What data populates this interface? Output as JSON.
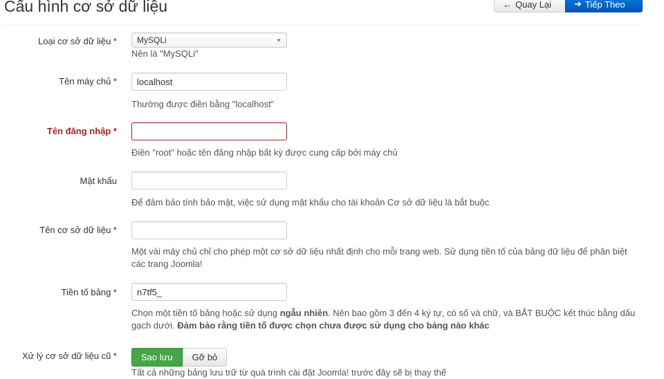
{
  "title": "Cấu hình cơ sở dữ liệu",
  "buttons": {
    "back": "Quay Lại",
    "next": "Tiếp Theo"
  },
  "fields": [
    {
      "label": "Loại cơ sở dữ liệu *",
      "value": "MySQLi",
      "help": "Nên là \"MySQLi\""
    },
    {
      "label": "Tên máy chủ *",
      "value": "localhost",
      "help": "Thường được điền bằng \"localhost\""
    },
    {
      "label": "Tên đăng nhập *",
      "value": "",
      "help": "Điền \"root\" hoặc tên đăng nhập bất kỳ được cung cấp bởi máy chủ"
    },
    {
      "label": "Mật khẩu",
      "value": "",
      "help": "Để đảm bảo tính bảo mật, việc sử dụng mật khẩu cho tài khoản Cơ sở dữ liệu là bắt buộc"
    },
    {
      "label": "Tên cơ sở dữ liệu *",
      "value": "",
      "help": "Một vài máy chủ chỉ cho phép một cơ sở dữ liệu nhất định cho mỗi trang web. Sử dụng tiền tố của bảng dữ liệu để phân biệt các trang Joomla!"
    },
    {
      "label": "Tiền tố bảng *",
      "value": "n7tf5_",
      "help_a": "Chọn một tiền tố bảng hoặc sử dụng ",
      "help_b": "ngẫu nhiên",
      "help_c": ". Nên bao gồm 3 đến 4 ký tự, có số và chữ, và BẮT BUỘC kết thúc bằng dấu gạch dưới. ",
      "help_d": "Đảm bảo rằng tiền tố được chọn chưa được sử dụng cho bảng nào khác"
    },
    {
      "label": "Xử lý cơ sở dữ liệu cũ *",
      "options": [
        "Sao lưu",
        "Gỡ bỏ"
      ],
      "help": "Tất cả những bảng lưu trữ từ quá trình cài đặt Joomla! trước đây sẽ bị thay thế"
    }
  ]
}
